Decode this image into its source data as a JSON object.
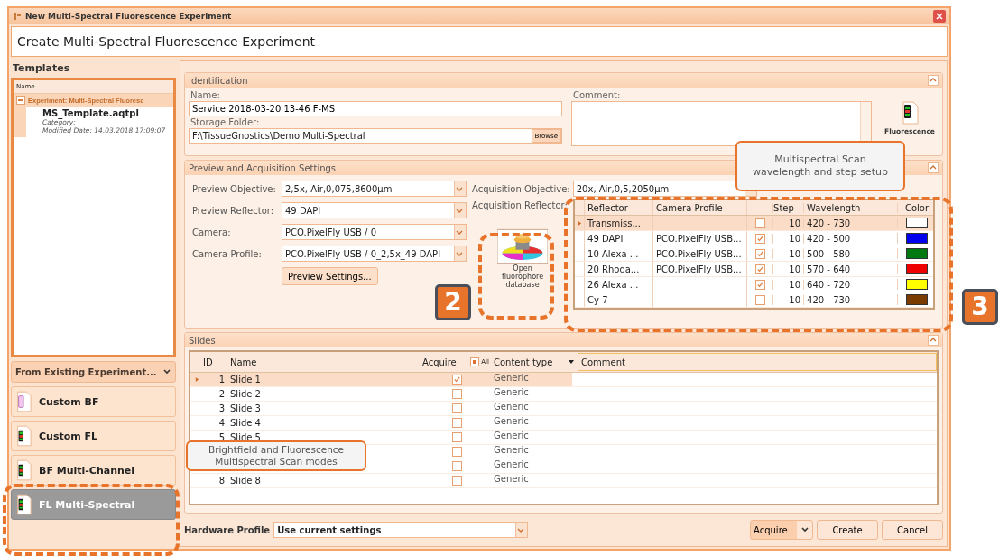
{
  "window": {
    "title": "New Multi-Spectral Fluorescence Experiment"
  },
  "header": {
    "title": "Create Multi-Spectral Fluorescence Experiment"
  },
  "templates": {
    "title": "Templates",
    "column_header": "Name",
    "group": {
      "label": "Experiment: Multi-Spectral Fluoresc",
      "expanded": true
    },
    "item": {
      "name": "MS_Template.aqtpl",
      "category": "Category:",
      "modified": "Modified Date: 14.03.2018 17:09:07",
      "selected": true
    }
  },
  "from_existing": {
    "label": "From Existing Experiment..."
  },
  "modes": [
    {
      "label": "Custom BF",
      "kind": "bf",
      "selected": false
    },
    {
      "label": "Custom FL",
      "kind": "fl",
      "selected": false
    },
    {
      "label": "BF Multi-Channel",
      "kind": "fl",
      "selected": false
    },
    {
      "label": "FL Multi-Spectral",
      "kind": "fl",
      "selected": true
    }
  ],
  "identification": {
    "title": "Identification",
    "name_label": "Name:",
    "name": "Service 2018-03-20 13-46 F-MS",
    "storage_label": "Storage Folder:",
    "storage": "F:\\TissueGnostics\\Demo Multi-Spectral",
    "browse": "Browse",
    "comment_label": "Comment:",
    "type_label": "Fluorescence"
  },
  "preview": {
    "title": "Preview and Acquisition Settings",
    "fields": [
      {
        "label": "Preview Objective:",
        "value": "2,5x, Air,0,075,8600µm"
      },
      {
        "label": "Preview Reflector:",
        "value": "49 DAPI"
      },
      {
        "label": "Camera:",
        "value": "PCO.PixelFly USB / 0"
      },
      {
        "label": "Camera Profile:",
        "value": "PCO.PixelFly USB / 0_2,5x_49 DAPI"
      }
    ],
    "preview_settings": "Preview Settings...",
    "acquisition_objective": {
      "label": "Acquisition Objective:",
      "value": "20x, Air,0,5,2050µm"
    },
    "acquisition_reflector_label": "Acquisition Reflector:",
    "fluorophore_button": "Open fluorophore database",
    "reflector_table": {
      "columns": {
        "reflector": "Reflector",
        "camera_profile": "Camera Profile",
        "step": "Step",
        "wavelength": "Wavelength",
        "color_heading": "Color"
      },
      "rows": [
        {
          "reflector": "Transmiss...",
          "checked": false,
          "step": "10",
          "wavelength": "420 - 730",
          "color": "#ffffff",
          "selected": true
        },
        {
          "reflector": "49 DAPI",
          "camera_profile": "PCO.PixelFly USB...",
          "checked": true,
          "step": "10",
          "wavelength": "420 - 500",
          "color": "#0000ee",
          "selected": false
        },
        {
          "reflector": "10 Alexa ...",
          "camera_profile": "PCO.PixelFly USB...",
          "checked": true,
          "step": "10",
          "wavelength": "500 - 580",
          "color": "#007a10",
          "selected": false
        },
        {
          "reflector": "20 Rhoda...",
          "camera_profile": "PCO.PixelFly USB...",
          "checked": true,
          "step": "10",
          "wavelength": "570 - 640",
          "color": "#ee0000",
          "selected": false
        },
        {
          "reflector": "26 Alexa ...",
          "checked": true,
          "step": "10",
          "wavelength": "640 - 720",
          "color": "#ffff00",
          "selected": false
        },
        {
          "reflector": "Cy 7",
          "checked": false,
          "step": "10",
          "wavelength": "420 - 730",
          "color": "#7a3b00",
          "selected": false
        }
      ]
    }
  },
  "slides": {
    "title": "Slides",
    "columns": {
      "id": "ID",
      "name": "Name",
      "acquire": "Acquire",
      "all": "All",
      "content_type": "Content type",
      "comment": "Comment"
    },
    "all_indeterminate": true,
    "rows": [
      {
        "id": "1",
        "name": "Slide 1",
        "acquire": true,
        "content_type": "Generic",
        "selected": true
      },
      {
        "id": "2",
        "name": "Slide 2",
        "acquire": false,
        "content_type": "Generic",
        "selected": false
      },
      {
        "id": "3",
        "name": "Slide 3",
        "acquire": false,
        "content_type": "Generic",
        "selected": false
      },
      {
        "id": "4",
        "name": "Slide 4",
        "acquire": false,
        "content_type": "Generic",
        "selected": false
      },
      {
        "id": "5",
        "name": "Slide 5",
        "acquire": false,
        "content_type": "Generic",
        "selected": false
      },
      {
        "acquire": false,
        "content_type": "Generic",
        "selected": false
      },
      {
        "acquire": false,
        "content_type": "Generic",
        "selected": false
      },
      {
        "id": "8",
        "name": "Slide 8",
        "acquire": false,
        "content_type": "Generic",
        "selected": false
      }
    ]
  },
  "footer": {
    "hardware_label": "Hardware Profile",
    "hardware_value": "Use current settings",
    "acquire": "Acquire",
    "create": "Create",
    "cancel": "Cancel"
  },
  "annotations": {
    "callouts": [
      "Multispectral Scan wavelength and  step setup",
      "Brightfield and Fluorescence Multispectral Scan modes"
    ],
    "badges": [
      "2",
      "3"
    ]
  }
}
